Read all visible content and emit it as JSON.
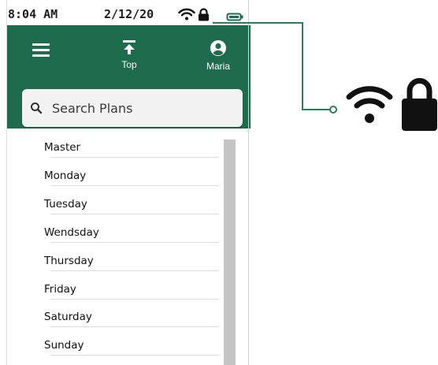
{
  "status_bar": {
    "time": "8:04 AM",
    "date": "2/12/20"
  },
  "header": {
    "menu_icon": "hamburger-menu-icon",
    "top_label": "Top",
    "top_icon": "arrow-up-to-line-icon",
    "user_label": "Maria",
    "user_icon": "user-circle-icon"
  },
  "search": {
    "placeholder": "Search Plans",
    "icon": "search-icon"
  },
  "plans": [
    "Master",
    "Monday",
    "Tuesday",
    "Wendsday",
    "Thursday",
    "Friday",
    "Saturday",
    "Sunday"
  ],
  "callout": {
    "icons": [
      "wifi-icon",
      "lock-icon"
    ]
  },
  "colors": {
    "header_green": "#1f6b4d",
    "callout_green": "#2e7d5b",
    "scrollbar": "#c4c4c4"
  }
}
